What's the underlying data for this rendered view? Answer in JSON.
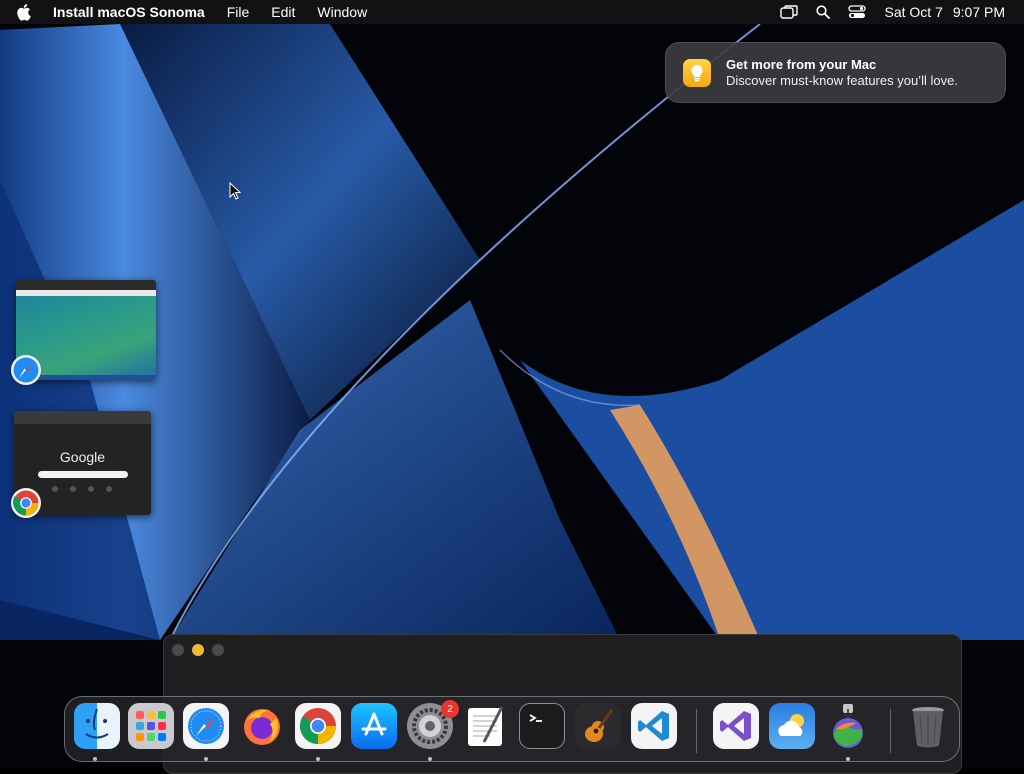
{
  "menubar": {
    "app_name": "Install macOS Sonoma",
    "menus": [
      "File",
      "Edit",
      "Window"
    ],
    "status_icons": [
      "screen-mirroring-icon",
      "search-icon",
      "control-center-icon"
    ],
    "date": "Sat Oct 7",
    "time": "9:07 PM"
  },
  "notification": {
    "icon": "lightbulb-icon",
    "title": "Get more from your Mac",
    "body": "Discover must-know features you’ll love."
  },
  "stage_manager": {
    "windows": [
      {
        "app": "Safari",
        "icon": "safari-icon"
      },
      {
        "app": "Google Chrome",
        "icon": "chrome-icon",
        "page_logo": "Google"
      }
    ]
  },
  "dock": {
    "apps": [
      {
        "name": "Finder",
        "icon": "finder-icon",
        "running": true
      },
      {
        "name": "Launchpad",
        "icon": "launchpad-icon",
        "running": false
      },
      {
        "name": "Safari",
        "icon": "safari-icon",
        "running": true
      },
      {
        "name": "Firefox",
        "icon": "firefox-icon",
        "running": false
      },
      {
        "name": "Google Chrome",
        "icon": "chrome-icon",
        "running": true
      },
      {
        "name": "App Store",
        "icon": "app-store-icon",
        "running": false
      },
      {
        "name": "System Settings",
        "icon": "system-settings-icon",
        "running": true,
        "badge": "2"
      },
      {
        "name": "TextEdit",
        "icon": "textedit-icon",
        "running": false
      },
      {
        "name": "Terminal",
        "icon": "terminal-icon",
        "running": false
      },
      {
        "name": "GarageBand",
        "icon": "garageband-icon",
        "running": false
      },
      {
        "name": "Visual Studio Code",
        "icon": "vscode-icon",
        "running": false
      },
      {
        "name": "Visual Studio",
        "icon": "visual-studio-icon",
        "running": false
      },
      {
        "name": "Weather",
        "icon": "weather-icon",
        "running": false
      },
      {
        "name": "Install macOS Sonoma",
        "icon": "install-macos-icon",
        "running": true
      },
      {
        "name": "Trash",
        "icon": "trash-icon",
        "running": false
      }
    ]
  },
  "colors": {
    "menubar_bg": "#141416",
    "accent_yellow": "#f0b82d",
    "badge_red": "#e8362f"
  }
}
